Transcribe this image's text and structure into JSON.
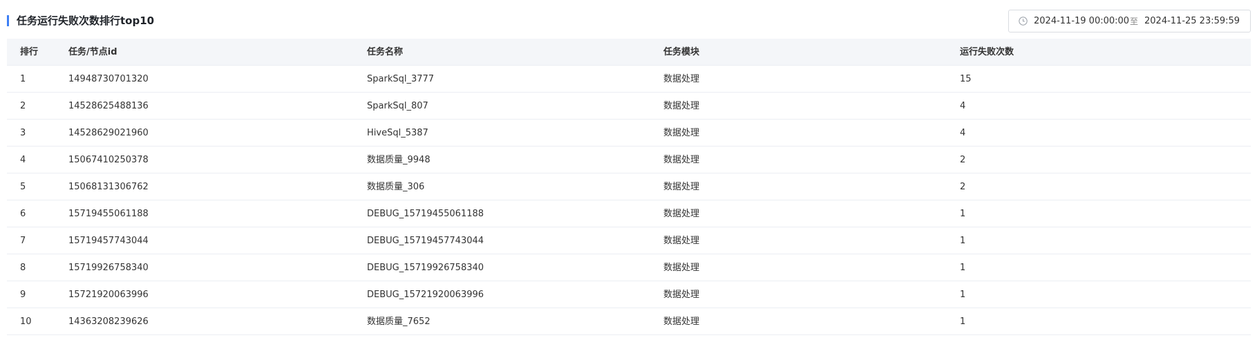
{
  "header": {
    "title": "任务运行失败次数排行top10",
    "accent_color": "#3d7ff5"
  },
  "date_range": {
    "icon": "clock-icon",
    "start": "2024-11-19 00:00:00",
    "separator": "至",
    "end": "2024-11-25 23:59:59"
  },
  "table": {
    "columns": [
      "排行",
      "任务/节点id",
      "任务名称",
      "任务模块",
      "运行失败次数"
    ],
    "rows": [
      {
        "rank": "1",
        "id": "14948730701320",
        "name": "SparkSql_3777",
        "module": "数据处理",
        "failures": "15"
      },
      {
        "rank": "2",
        "id": "14528625488136",
        "name": "SparkSql_807",
        "module": "数据处理",
        "failures": "4"
      },
      {
        "rank": "3",
        "id": "14528629021960",
        "name": "HiveSql_5387",
        "module": "数据处理",
        "failures": "4"
      },
      {
        "rank": "4",
        "id": "15067410250378",
        "name": "数据质量_9948",
        "module": "数据处理",
        "failures": "2"
      },
      {
        "rank": "5",
        "id": "15068131306762",
        "name": "数据质量_306",
        "module": "数据处理",
        "failures": "2"
      },
      {
        "rank": "6",
        "id": "15719455061188",
        "name": "DEBUG_15719455061188",
        "module": "数据处理",
        "failures": "1"
      },
      {
        "rank": "7",
        "id": "15719457743044",
        "name": "DEBUG_15719457743044",
        "module": "数据处理",
        "failures": "1"
      },
      {
        "rank": "8",
        "id": "15719926758340",
        "name": "DEBUG_15719926758340",
        "module": "数据处理",
        "failures": "1"
      },
      {
        "rank": "9",
        "id": "15721920063996",
        "name": "DEBUG_15721920063996",
        "module": "数据处理",
        "failures": "1"
      },
      {
        "rank": "10",
        "id": "14363208239626",
        "name": "数据质量_7652",
        "module": "数据处理",
        "failures": "1"
      }
    ]
  }
}
